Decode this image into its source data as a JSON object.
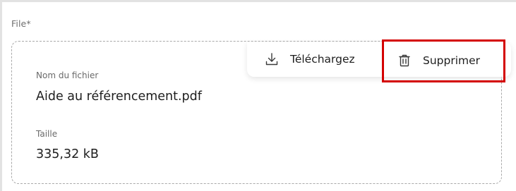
{
  "field": {
    "label": "File*"
  },
  "file": {
    "name_label": "Nom du fichier",
    "name_value": "Aide au référencement.pdf",
    "size_label": "Taille",
    "size_value": "335,32 kB"
  },
  "actions": {
    "download_label": "Téléchargez",
    "download_icon": "download-icon",
    "delete_label": "Supprimer",
    "delete_icon": "trash-icon"
  },
  "colors": {
    "highlight": "#d40000",
    "text": "#1e1e1e",
    "muted": "#6a6a6a"
  }
}
